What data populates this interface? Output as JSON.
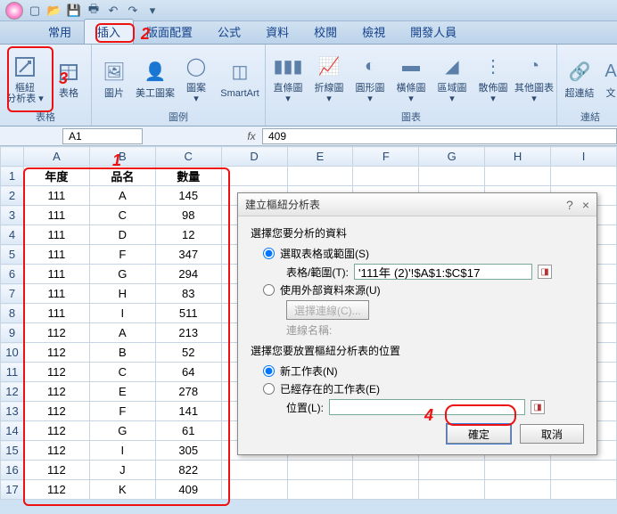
{
  "qat_icons": [
    "new",
    "open",
    "save",
    "print",
    "undo",
    "redo",
    "touch",
    "zoom",
    "mail"
  ],
  "tabs": [
    "常用",
    "插入",
    "版面配置",
    "公式",
    "資料",
    "校閱",
    "檢視",
    "開發人員"
  ],
  "active_tab_index": 1,
  "ribbon": {
    "groups": [
      {
        "label": "表格",
        "items": [
          {
            "l1": "樞紐",
            "l2": "分析表",
            "icon": "pivot"
          },
          {
            "l1": "表格",
            "icon": "table"
          }
        ]
      },
      {
        "label": "圖例",
        "items": [
          {
            "l1": "圖片",
            "icon": "pic"
          },
          {
            "l1": "美工圖案",
            "icon": "clip"
          },
          {
            "l1": "圖案",
            "icon": "shapes"
          },
          {
            "l1": "SmartArt",
            "icon": "smart"
          }
        ]
      },
      {
        "label": "圖表",
        "items": [
          {
            "l1": "直條圖",
            "icon": "bar"
          },
          {
            "l1": "折線圖",
            "icon": "line"
          },
          {
            "l1": "圓形圖",
            "icon": "pie"
          },
          {
            "l1": "橫條圖",
            "icon": "hbar"
          },
          {
            "l1": "區域圖",
            "icon": "area"
          },
          {
            "l1": "散佈圖",
            "icon": "scatter"
          },
          {
            "l1": "其他圖表",
            "icon": "other"
          }
        ]
      },
      {
        "label": "連結",
        "items": [
          {
            "l1": "超連結",
            "icon": "link"
          },
          {
            "l1": "文",
            "icon": "txt"
          }
        ]
      }
    ]
  },
  "namebox": "A1",
  "fx": "fx",
  "fxval": "409",
  "cols": [
    "A",
    "B",
    "C",
    "D",
    "E",
    "F",
    "G",
    "H",
    "I"
  ],
  "headers": [
    "年度",
    "品名",
    "數量"
  ],
  "rows": [
    [
      "111",
      "A",
      "145"
    ],
    [
      "111",
      "C",
      "98"
    ],
    [
      "111",
      "D",
      "12"
    ],
    [
      "111",
      "F",
      "347"
    ],
    [
      "111",
      "G",
      "294"
    ],
    [
      "111",
      "H",
      "83"
    ],
    [
      "111",
      "I",
      "511"
    ],
    [
      "112",
      "A",
      "213"
    ],
    [
      "112",
      "B",
      "52"
    ],
    [
      "112",
      "C",
      "64"
    ],
    [
      "112",
      "E",
      "278"
    ],
    [
      "112",
      "F",
      "141"
    ],
    [
      "112",
      "G",
      "61"
    ],
    [
      "112",
      "I",
      "305"
    ],
    [
      "112",
      "J",
      "822"
    ],
    [
      "112",
      "K",
      "409"
    ]
  ],
  "dialog": {
    "title": "建立樞紐分析表",
    "help": "?",
    "close": "×",
    "sect1": "選擇您要分析的資料",
    "opt1": "選取表格或範圍(S)",
    "range_label": "表格/範圍(T):",
    "range_value": "'111年 (2)'!$A$1:$C$17",
    "opt2": "使用外部資料來源(U)",
    "choose_conn": "選擇連線(C)...",
    "conn_name": "連線名稱:",
    "sect2": "選擇您要放置樞紐分析表的位置",
    "opt3": "新工作表(N)",
    "opt4": "已經存在的工作表(E)",
    "loc_label": "位置(L):",
    "ok": "確定",
    "cancel": "取消"
  },
  "annot": {
    "n1": "1",
    "n2": "2",
    "n3": "3",
    "n4": "4"
  }
}
